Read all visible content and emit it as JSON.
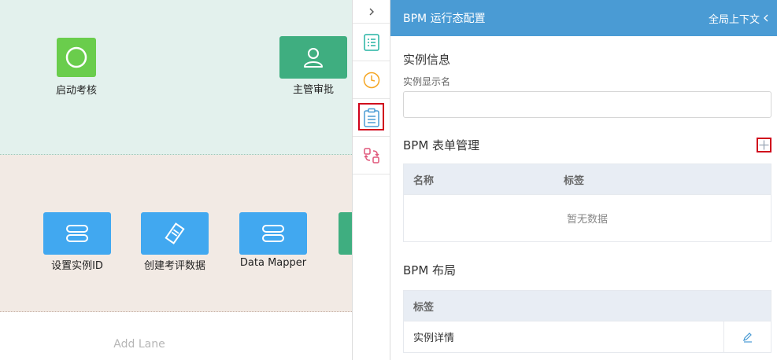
{
  "canvas": {
    "nodes": [
      {
        "label": "启动考核",
        "icon": "circle-icon"
      },
      {
        "label": "主管审批",
        "icon": "user-icon"
      },
      {
        "label": "设置实例ID",
        "icon": "server-icon"
      },
      {
        "label": "创建考评数据",
        "icon": "edit-doc-icon"
      },
      {
        "label": "Data Mapper",
        "icon": "server-icon"
      }
    ],
    "add_lane": "Add Lane"
  },
  "rail": {
    "collapse_icon": "chevron-right-icon",
    "items": [
      "list-icon",
      "clock-icon",
      "form-icon",
      "swap-icon"
    ]
  },
  "panel": {
    "title": "BPM 运行态配置",
    "context_label": "全局上下文",
    "instance": {
      "section_title": "实例信息",
      "display_name_label": "实例显示名",
      "display_name_value": ""
    },
    "forms": {
      "section_title": "BPM 表单管理",
      "columns": [
        "名称",
        "标签"
      ],
      "empty_text": "暂无数据"
    },
    "layout": {
      "section_title": "BPM 布局",
      "column": "标签",
      "rows": [
        "实例详情"
      ]
    }
  },
  "colors": {
    "header": "#4a9bd4",
    "lane_top": "#e3f1ed",
    "lane_mid": "#f2eae4",
    "node_blue": "#41a8f0",
    "node_green": "#3fae80",
    "node_green_light": "#6acd4c",
    "highlight": "#d0021b"
  }
}
